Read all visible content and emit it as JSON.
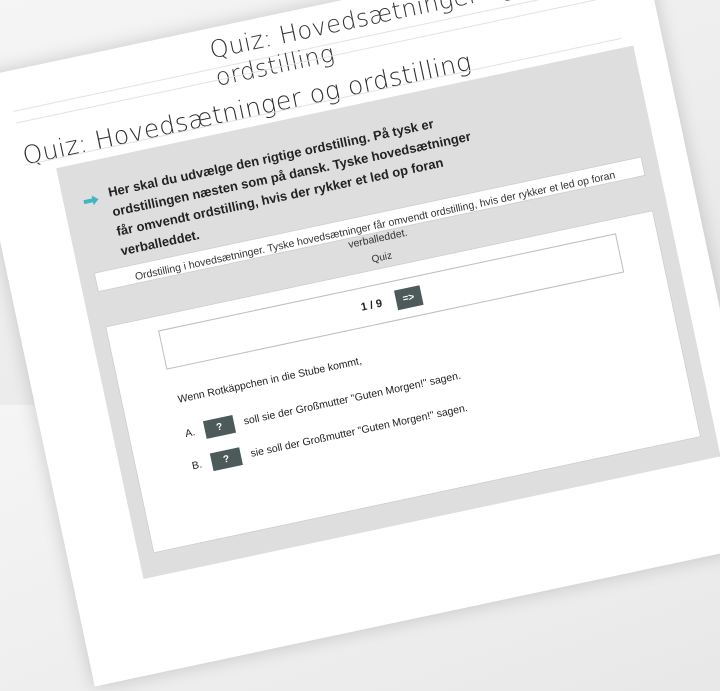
{
  "header": {
    "title_upper": "Quiz: Hovedsætninger og ordstilling",
    "title": "Quiz: Hovedsætninger og ordstilling"
  },
  "intro": {
    "text": "Her skal du udvælge den rigtige ordstilling. På tysk er ordstillingen næsten som på dansk. Tyske hovedsætninger får omvendt ordstilling, hvis der rykker et led op foran verballeddet."
  },
  "embed": {
    "title": "Ordstilling i hovedsætninger. Tyske hovedsætninger får omvendt ordstilling, hvis der rykker et led op foran verballeddet.",
    "subtitle": "Quiz"
  },
  "quiz": {
    "progress": "1 / 9",
    "next_label": "=>",
    "question": "Wenn Rotkäppchen in die Stube kommt,",
    "options": [
      {
        "letter": "A.",
        "button": "?",
        "text": "soll sie der Großmutter \"Guten Morgen!\" sagen."
      },
      {
        "letter": "B.",
        "button": "?",
        "text": "sie soll der Großmutter \"Guten Morgen!\" sagen."
      }
    ]
  },
  "colors": {
    "accent_arrow": "#3fb6c0",
    "button_bg": "#4c5a5a",
    "box_bg": "#dedede"
  }
}
